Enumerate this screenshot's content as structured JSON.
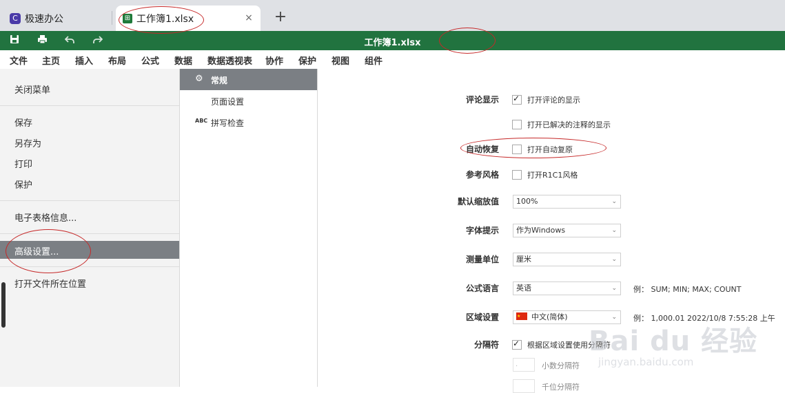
{
  "browser": {
    "app_tab_label": "极速办公",
    "doc_tab_label": "工作簿1.xlsx",
    "close_symbol": "×",
    "new_tab_symbol": "+"
  },
  "titlebar": {
    "title": "工作簿1.xlsx",
    "icons": [
      "save-icon",
      "print-icon",
      "undo-icon",
      "redo-icon"
    ]
  },
  "menu": {
    "items": [
      "文件",
      "主页",
      "插入",
      "布局",
      "公式",
      "数据",
      "数据透视表",
      "协作",
      "保护",
      "视图",
      "组件"
    ]
  },
  "left_menu": {
    "close_menu": "关闭菜单",
    "save": "保存",
    "save_as": "另存为",
    "print": "打印",
    "protect": "保护",
    "spreadsheet_info": "电子表格信息...",
    "advanced_settings": "高级设置...",
    "open_file_location": "打开文件所在位置"
  },
  "mid_menu": {
    "general": "常规",
    "page_setup": "页面设置",
    "spell_check": "拼写检查",
    "spell_icon_text": "ABC"
  },
  "settings": {
    "comments_label": "评论显示",
    "comments_show": "打开评论的显示",
    "comments_show_checked": true,
    "resolved_show": "打开已解决的注释的显示",
    "resolved_show_checked": false,
    "autorecover_label": "自动恢复",
    "autorecover_text": "打开自动复原",
    "autorecover_checked": false,
    "ref_style_label": "参考风格",
    "ref_style_text": "打开R1C1风格",
    "ref_style_checked": false,
    "zoom_label": "默认缩放值",
    "zoom_value": "100%",
    "font_hint_label": "字体提示",
    "font_hint_value": "作为Windows",
    "unit_label": "测量单位",
    "unit_value": "厘米",
    "formula_lang_label": "公式语言",
    "formula_lang_value": "英语",
    "formula_example": "例： SUM; MIN; MAX; COUNT",
    "region_label": "区域设置",
    "region_value": "中文(简体)",
    "region_example": "例： 1,000.01 2022/10/8 7:55:28 上午",
    "separator_label": "分隔符",
    "separator_text": "根据区域设置使用分隔符",
    "separator_checked": true,
    "decimal_value": ".",
    "decimal_label": "小数分隔符",
    "thousands_label": "千位分隔符"
  },
  "watermark": {
    "brand": "Bai du 经验",
    "url": "jingyan.baidu.com"
  },
  "colors": {
    "brand_green": "#21733f",
    "annotation_red": "#c62828",
    "selected_grey": "#7b7f84"
  }
}
